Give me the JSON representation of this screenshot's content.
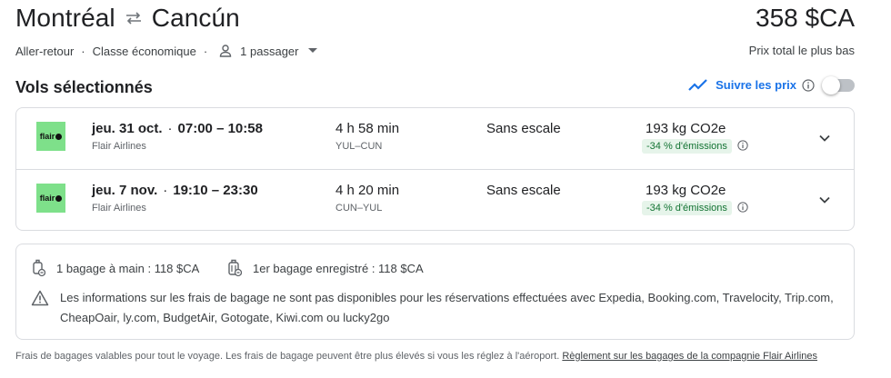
{
  "header": {
    "origin": "Montréal",
    "destination": "Cancún",
    "swap_icon": "swap-arrows-icon",
    "price": "358 $CA",
    "price_label": "Prix total le plus bas",
    "trip_type": "Aller-retour",
    "cabin_class": "Classe économique",
    "passengers": "1 passager"
  },
  "section": {
    "title": "Vols sélectionnés",
    "track_prices_label": "Suivre les prix",
    "track_enabled": false
  },
  "flights": [
    {
      "date": "jeu. 31 oct.",
      "times": "07:00 – 10:58",
      "airline": "Flair Airlines",
      "logo_text": "flair",
      "duration": "4 h 58 min",
      "airports": "YUL–CUN",
      "stops": "Sans escale",
      "co2": "193 kg CO2e",
      "emissions": "-34 % d'émissions"
    },
    {
      "date": "jeu. 7 nov.",
      "times": "19:10 – 23:30",
      "airline": "Flair Airlines",
      "logo_text": "flair",
      "duration": "4 h 20 min",
      "airports": "CUN–YUL",
      "stops": "Sans escale",
      "co2": "193 kg CO2e",
      "emissions": "-34 % d'émissions"
    }
  ],
  "baggage": {
    "carry_on": "1 bagage à main : 118 $CA",
    "checked": "1er bagage enregistré : 118 $CA",
    "warning": "Les informations sur les frais de bagage ne sont pas disponibles pour les réservations effectuées avec Expedia, Booking.com, Travelocity, Trip.com, CheapOair, ly.com, BudgetAir, Gotogate, Kiwi.com ou lucky2go"
  },
  "footer": {
    "text": "Frais de bagages valables pour tout le voyage. Les frais de bagage peuvent être plus élevés si vous les réglez à l'aéroport.",
    "link": "Règlement sur les bagages de la compagnie Flair Airlines"
  },
  "colors": {
    "accent": "#1a73e8",
    "logo_bg": "#7ee08a",
    "emissions_bg": "#e6f4ea",
    "emissions_text": "#137333",
    "border": "#dadce0"
  }
}
